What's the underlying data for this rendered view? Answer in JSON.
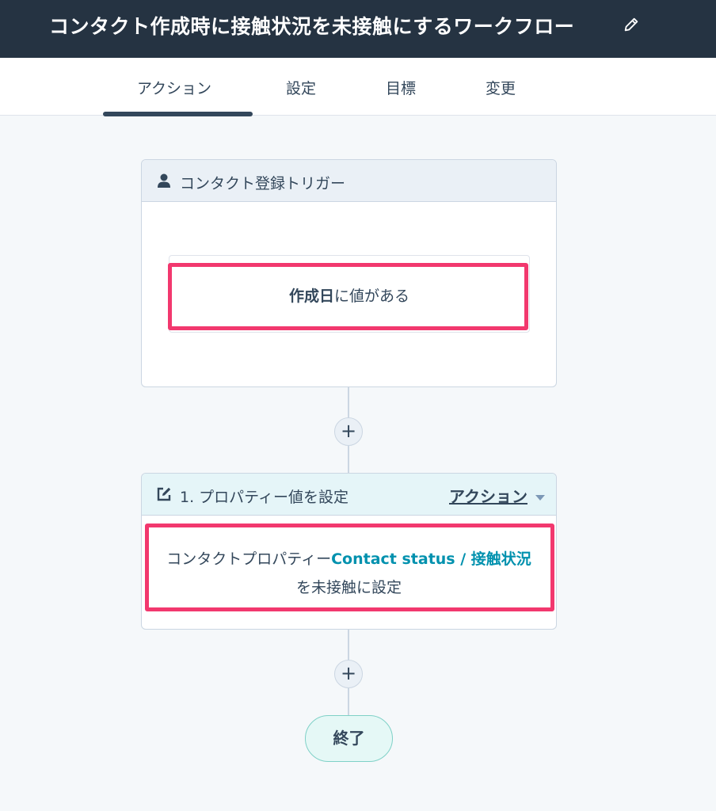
{
  "header": {
    "title": "コンタクト作成時に接触状況を未接触にするワークフロー",
    "edit_icon": "pencil-icon"
  },
  "tabs": [
    {
      "label": "アクション",
      "active": true
    },
    {
      "label": "設定",
      "active": false
    },
    {
      "label": "目標",
      "active": false
    },
    {
      "label": "変更",
      "active": false
    }
  ],
  "trigger": {
    "icon": "person-icon",
    "title": "コンタクト登録トリガー",
    "filter": {
      "property": "作成日",
      "condition": "に値がある"
    }
  },
  "action_step": {
    "icon": "edit-box-icon",
    "title": "1. プロパティー値を設定",
    "menu_label": "アクション",
    "body_prefix": "コンタクトプロパティー",
    "property_link": "Contact status / 接触状況",
    "body_suffix": "を未接触に設定"
  },
  "add_step_symbol": "+",
  "end_label": "終了",
  "colors": {
    "header_bg": "#253342",
    "highlight": "#f2386e",
    "link": "#0091ae",
    "text": "#33475b"
  }
}
